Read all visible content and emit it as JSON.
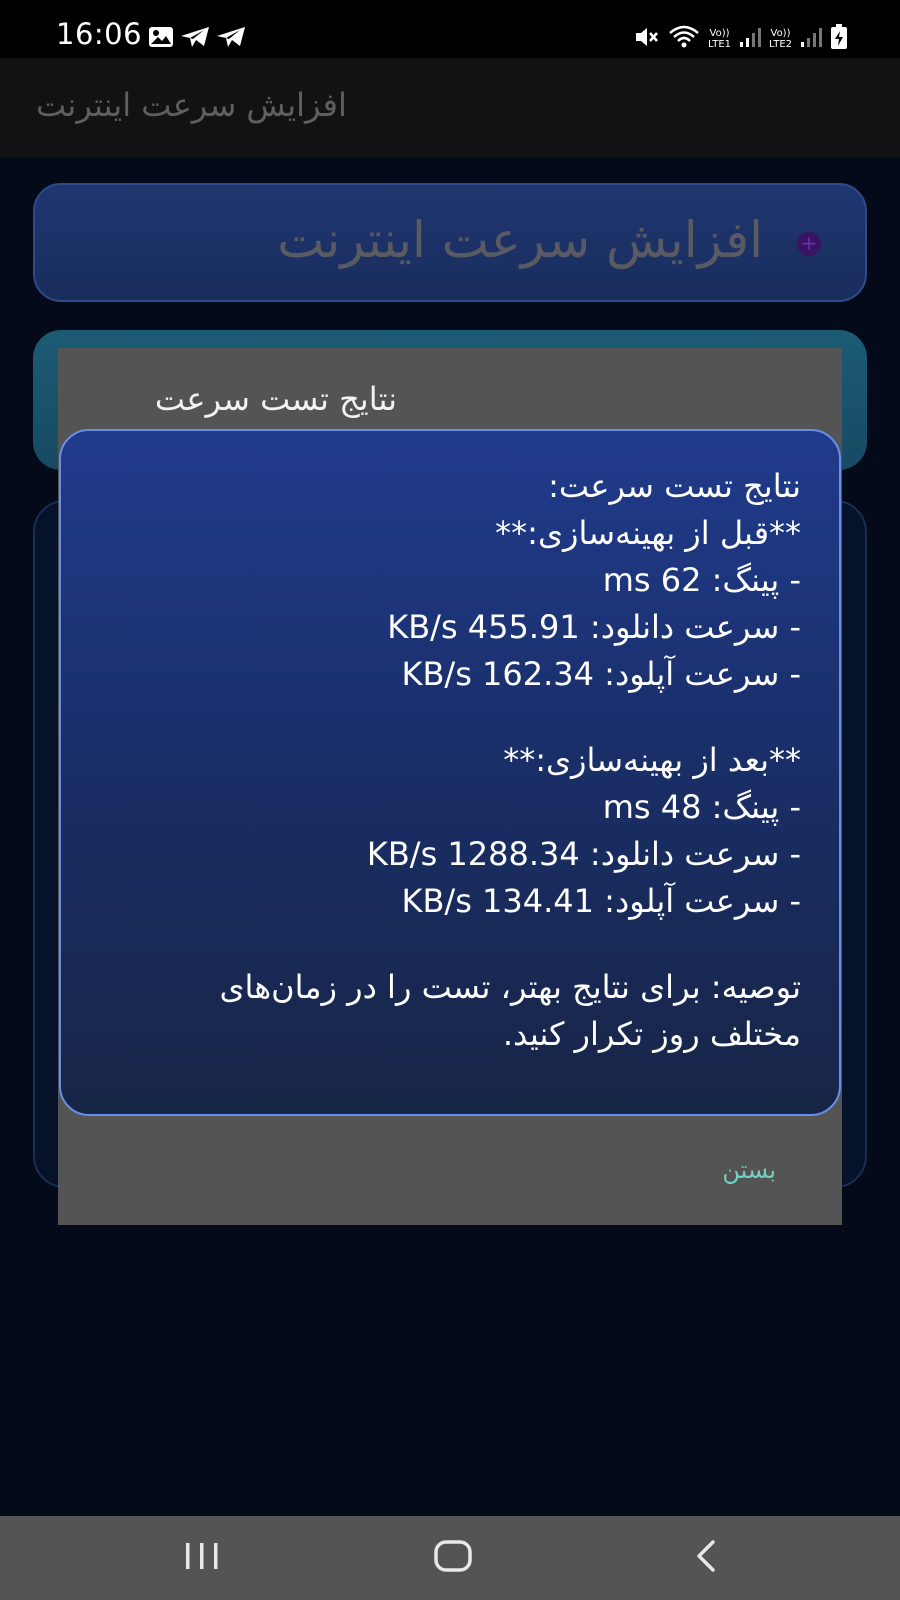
{
  "status_bar": {
    "time": "16:06",
    "left_icons": [
      "image-icon",
      "telegram-icon",
      "telegram-icon"
    ],
    "right_icons": [
      "mute-icon",
      "wifi-icon",
      "signal-icon",
      "signal-icon",
      "battery-charging-icon"
    ],
    "sim1_label_top": "Vo))",
    "sim1_label_bottom": "LTE1",
    "sim2_label_top": "Vo))",
    "sim2_label_bottom": "LTE2"
  },
  "app_bar": {
    "title": "افزایش سرعت اینترنت"
  },
  "header_card": {
    "title": "افزایش سرعت اینترنت",
    "dot_symbol": "+",
    "dot_color": "#3a1464"
  },
  "dialog": {
    "title": "نتایج تست سرعت",
    "results": {
      "heading": "نتایج تست سرعت:",
      "before_heading": "**قبل از بهینه‌سازی:**",
      "before_ping": "- پینگ: 62 ms",
      "before_download": "- سرعت دانلود: 455.91 KB/s",
      "before_upload": "- سرعت آپلود: 162.34 KB/s",
      "after_heading": "**بعد از بهینه‌سازی:**",
      "after_ping": "- پینگ: 48 ms",
      "after_download": "- سرعت دانلود: 1288.34 KB/s",
      "after_upload": "- سرعت آپلود: 134.41 KB/s",
      "tip_line1": "توصیه: برای نتایج بهتر، تست را در زمان‌های",
      "tip_line2": "مختلف روز تکرار کنید."
    },
    "close_label": "بستن",
    "close_color": "#6fd0c4"
  },
  "nav_bar": {
    "buttons": [
      "recent-apps-icon",
      "home-icon",
      "back-icon"
    ]
  },
  "colors": {
    "background": "#040a1a",
    "card_blue": "#1f3670",
    "card_teal": "#1c5b74",
    "dialog_gray": "#545454",
    "result_border": "#6a8ee6"
  }
}
